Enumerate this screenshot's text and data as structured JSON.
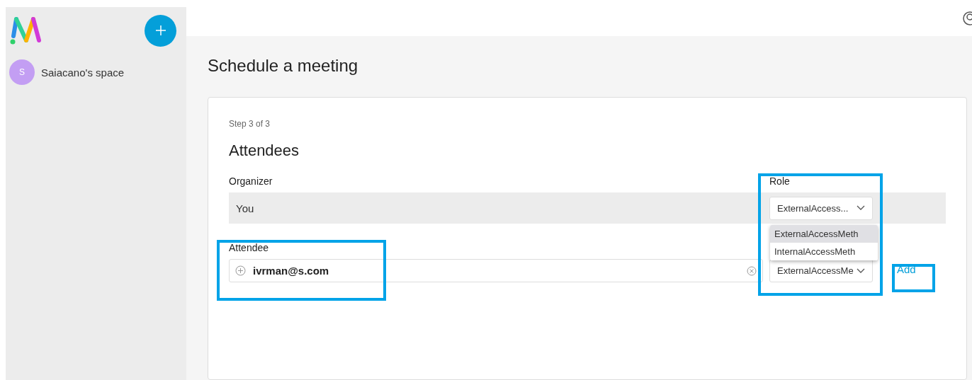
{
  "sidebar": {
    "spaces": [
      {
        "initial": "S",
        "name": "Saiacano's space",
        "color": "#c39ef3"
      }
    ]
  },
  "page_title": "Schedule a meeting",
  "form": {
    "step": "Step 3 of 3",
    "section_title": "Attendees",
    "organizer": {
      "label": "Organizer",
      "name": "You",
      "role_label": "Role",
      "role_value": "ExternalAccess..."
    },
    "role_menu": {
      "open": true,
      "options": [
        {
          "label": "ExternalAccessMeth",
          "selected": true
        },
        {
          "label": "InternalAccessMeth",
          "selected": false
        }
      ]
    },
    "attendee": {
      "label": "Attendee",
      "value": "ivrman@s.com",
      "role_value": "ExternalAccessMe"
    },
    "add_button": "Add"
  }
}
